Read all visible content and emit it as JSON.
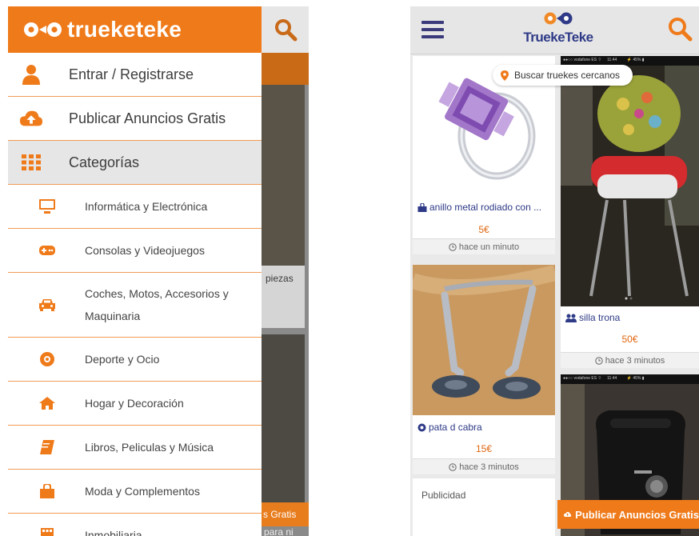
{
  "left_screen": {
    "brand": "trueketeke",
    "menu": {
      "login": "Entrar / Registrarse",
      "publish": "Publicar Anuncios Gratis",
      "categories_header": "Categorías",
      "categories": [
        {
          "label": "Informática y Electrónica",
          "icon": "monitor-icon"
        },
        {
          "label": "Consolas y Videojuegos",
          "icon": "gamepad-icon"
        },
        {
          "label": "Coches, Motos, Accesorios y Maquinaria",
          "icon": "car-icon"
        },
        {
          "label": "Deporte y Ocio",
          "icon": "soccer-ball-icon"
        },
        {
          "label": "Hogar y Decoración",
          "icon": "home-icon"
        },
        {
          "label": "Libros, Peliculas y Música",
          "icon": "book-icon"
        },
        {
          "label": "Moda y Complementos",
          "icon": "shopping-bag-icon"
        },
        {
          "label": "Inmobiliaria",
          "icon": "building-icon"
        }
      ]
    },
    "background": {
      "fragment_piezas": "piezas",
      "fragment_publicar": "s Gratis",
      "fragment_para": "para ni"
    }
  },
  "right_screen": {
    "brand": "TruekeTeke",
    "nearby_chip": "Buscar truekes cercanos",
    "listings": [
      {
        "title": "anillo metal rodiado con ...",
        "price": "5€",
        "time": "hace un minuto",
        "icon": "shopping-bag-icon"
      },
      {
        "title": "silla trona",
        "price": "50€",
        "time": "hace 3 minutos",
        "icon": "people-icon"
      },
      {
        "title": "pata d cabra",
        "price": "15€",
        "time": "hace 3 minutos",
        "icon": "soccer-ball-icon"
      }
    ],
    "ad_label": "Publicidad",
    "publish_button": "Publicar Anuncios Gratis",
    "colors": {
      "orange": "#ef7a1a",
      "navy": "#2e3a87",
      "price": "#e0660f"
    }
  }
}
